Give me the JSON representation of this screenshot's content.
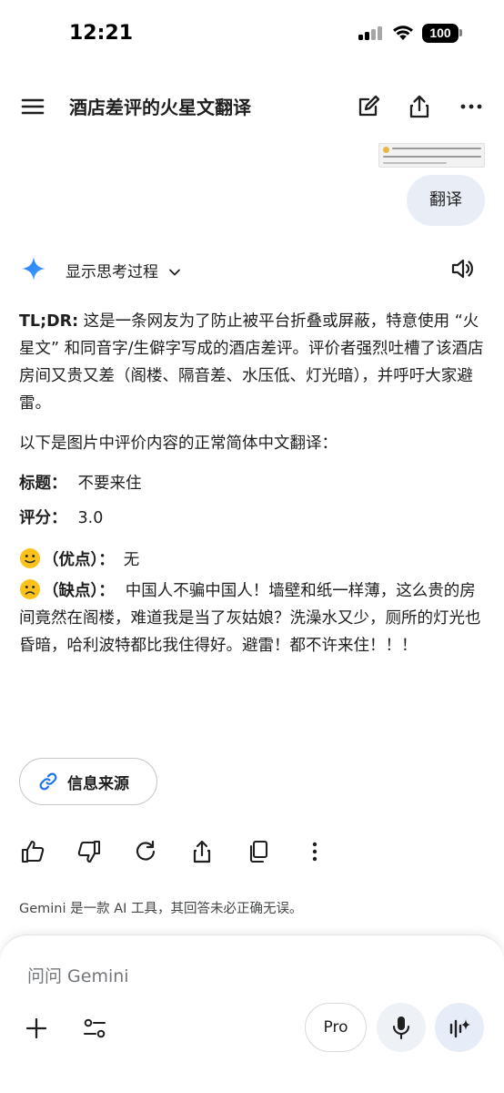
{
  "status": {
    "time": "12:21",
    "battery": "100"
  },
  "header": {
    "title": "酒店差评的火星文翻译"
  },
  "user_message": {
    "text": "翻译"
  },
  "thinking": {
    "label": "显示思考过程"
  },
  "answer": {
    "tldr_label": "TL;DR:",
    "tldr_text": " 这是一条网友为了防止被平台折叠或屏蔽，特意使用 “火星文” 和同音字/生僻字写成的酒店差评。评价者强烈吐槽了该酒店房间又贵又差（阁楼、隔音差、水压低、灯光暗），并呼吁大家避雷。",
    "intro": "以下是图片中评价内容的正常简体中文翻译：",
    "title_label": "标题：",
    "title_value": "不要来住",
    "score_label": "评分：",
    "score_value": "3.0",
    "pros_emoji": "slightly-smiling-face-emoji",
    "pros_label": "（优点）：",
    "pros_value": "无",
    "cons_emoji": "frowning-face-emoji",
    "cons_label": "（缺点）：",
    "cons_value": "中国人不骗中国人！墙壁和纸一样薄，这么贵的房间竟然在阁楼，难道我是当了灰姑娘？洗澡水又少，厕所的灯光也昏暗，哈利波特都比我住得好。避雷！都不许来住！！！"
  },
  "sources_button": {
    "label": "信息来源"
  },
  "disclaimer": "Gemini 是一款 AI 工具，其回答未必正确无误。",
  "composer": {
    "placeholder": "问问 Gemini",
    "pro_label": "Pro"
  },
  "colors": {
    "accent_blue": "#4285f4",
    "bubble": "#e9eef6",
    "text": "#1f1f1f"
  }
}
